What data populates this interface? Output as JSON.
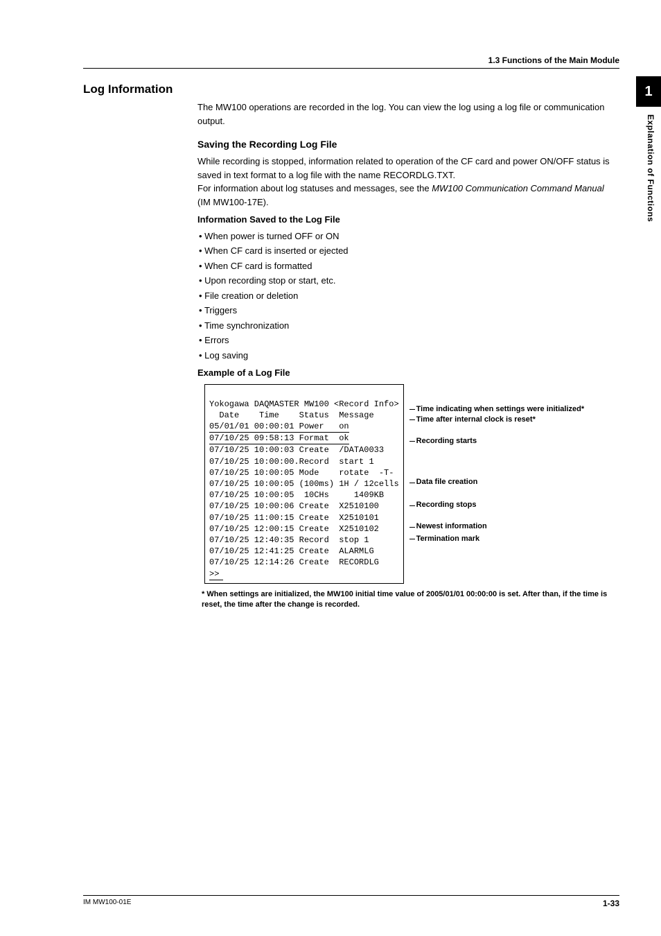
{
  "header": {
    "breadcrumb": "1.3  Functions of the Main Module"
  },
  "sideTab": {
    "chapter": "1",
    "label": "Explanation of Functions"
  },
  "title": "Log Information",
  "intro": "The MW100 operations are recorded in the log. You can view the log using a log file or communication output.",
  "saving": {
    "heading": "Saving the Recording Log File",
    "p1": "While recording is stopped, information related to operation of the CF card and power ON/OFF status is saved in text format to a log file with the name RECORDLG.TXT.",
    "p2a": "For information about log statuses and messages, see the ",
    "p2i": "MW100 Communication Command Manual",
    "p2b": " (IM MW100-17E)."
  },
  "infoSaved": {
    "heading": "Information Saved to the Log File",
    "items": [
      "When power is turned OFF or ON",
      "When CF card is inserted or ejected",
      "When CF card is formatted",
      "Upon recording stop or start, etc.",
      "File creation or deletion",
      "Triggers",
      "Time synchronization",
      "Errors",
      "Log saving"
    ]
  },
  "example": {
    "heading": "Example of a Log File",
    "lines": [
      "Yokogawa DAQMASTER MW100 <Record Info>",
      "  Date    Time    Status  Message",
      "05/01/01 00:00:01 Power   on",
      "07/10/25 09:58:13 Format  ok",
      "07/10/25 10:00:03 Create  /DATA0033",
      "07/10/25 10:00:00.Record  start 1",
      "07/10/25 10:00:05 Mode    rotate  -T-",
      "07/10/25 10:00:05 (100ms) 1H / 12cells",
      "07/10/25 10:00:05  10CHs     1409KB",
      "07/10/25 10:00:06 Create  X2510100",
      "07/10/25 11:00:15 Create  X2510101",
      "07/10/25 12:00:15 Create  X2510102",
      "07/10/25 12:40:35 Record  stop 1",
      "07/10/25 12:41:25 Create  ALARMLG",
      "07/10/25 12:14:26 Create  RECORDLG",
      ">>"
    ],
    "annotations": {
      "a1": "Time indicating when settings were initialized*",
      "a2": "Time after internal clock is reset*",
      "a3": "Recording starts",
      "a4": "Data file creation",
      "a5": "Recording stops",
      "a6": "Newest information",
      "a7": "Termination mark"
    },
    "footnote": "* When settings are initialized, the MW100 initial time value of 2005/01/01 00:00:00 is set. After than, if the time is reset, the time after the change is recorded."
  },
  "footer": {
    "left": "IM MW100-01E",
    "right": "1-33"
  }
}
